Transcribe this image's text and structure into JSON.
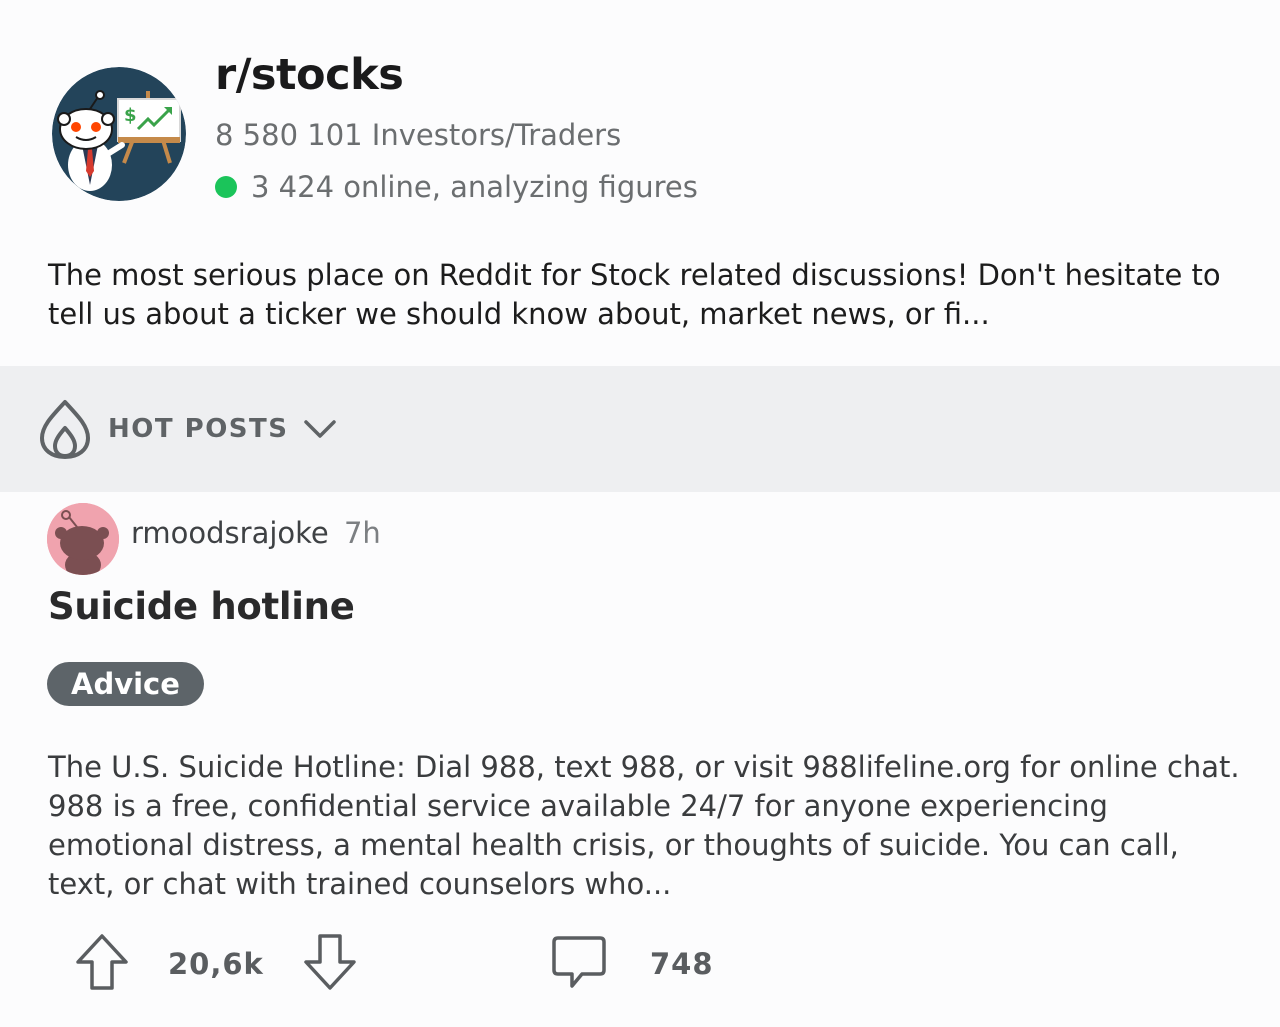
{
  "subreddit": {
    "name": "r/stocks",
    "members": "8 580 101 Investors/Traders",
    "online": "3 424 online, analyzing figures",
    "description": "The most serious place on Reddit for Stock related discussions!  Don't hesitate to tell us about a ticker we should know about, market news, or fi...",
    "avatar_icon": "snoo-investor-icon",
    "online_color": "#1bc45a"
  },
  "sort": {
    "label": "HOT POSTS",
    "icon": "flame-icon",
    "dropdown_icon": "chevron-down-icon"
  },
  "post": {
    "author": "rmoodsrajoke",
    "time": "7h",
    "title": "Suicide hotline",
    "flair": "Advice",
    "body": "The U.S. Suicide Hotline: Dial 988, text 988, or visit 988lifeline.org for online chat. 988 is a free, confidential service available 24/7 for anyone experiencing emotional distress, a mental health crisis, or thoughts of suicide. You can call, text, or chat with trained counselors who...",
    "votes": "20,6k",
    "comments": "748",
    "flair_color": "#5d6469"
  }
}
